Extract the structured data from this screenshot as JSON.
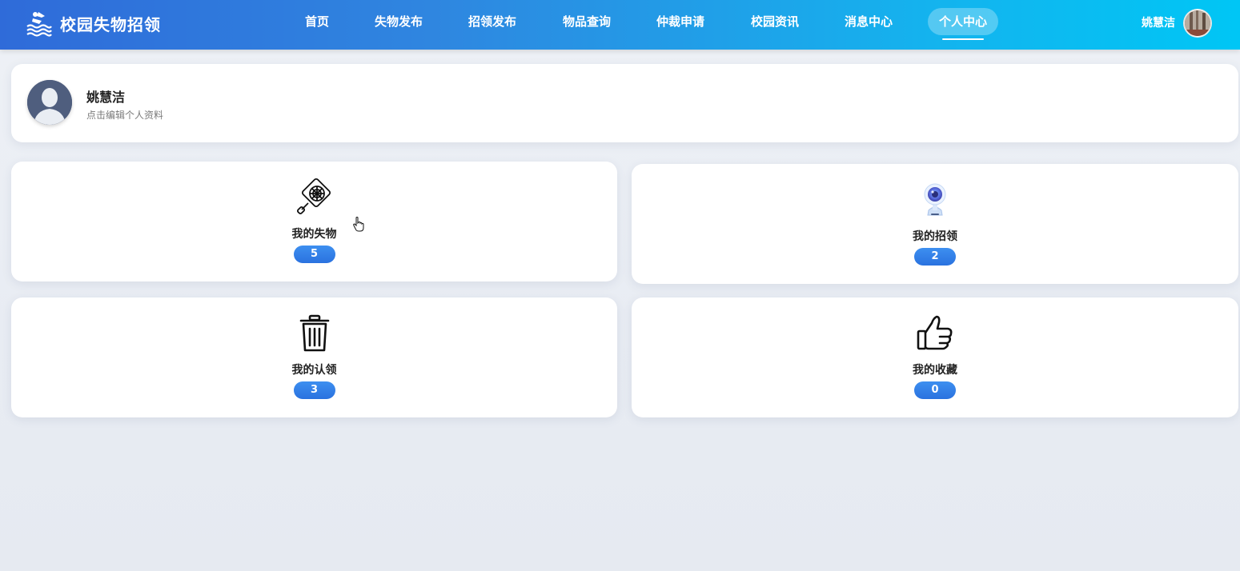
{
  "header": {
    "brand_title": "校园失物招领",
    "nav": [
      {
        "label": "首页"
      },
      {
        "label": "失物发布"
      },
      {
        "label": "招领发布"
      },
      {
        "label": "物品查询"
      },
      {
        "label": "仲裁申请"
      },
      {
        "label": "校园资讯"
      },
      {
        "label": "消息中心"
      },
      {
        "label": "个人中心",
        "active": true
      }
    ],
    "user_name": "姚慧洁"
  },
  "profile": {
    "name": "姚慧洁",
    "hint": "点击编辑个人资料"
  },
  "stats": [
    {
      "label": "我的失物",
      "count": "5",
      "icon": "lost-item-icon"
    },
    {
      "label": "我的招领",
      "count": "2",
      "icon": "camera-icon"
    },
    {
      "label": "我的认领",
      "count": "3",
      "icon": "trash-icon"
    },
    {
      "label": "我的收藏",
      "count": "0",
      "icon": "thumbs-up-icon"
    }
  ],
  "colors": {
    "header_start": "#2f6bd9",
    "header_end": "#00c6f5",
    "badge": "#2f7fe6"
  }
}
